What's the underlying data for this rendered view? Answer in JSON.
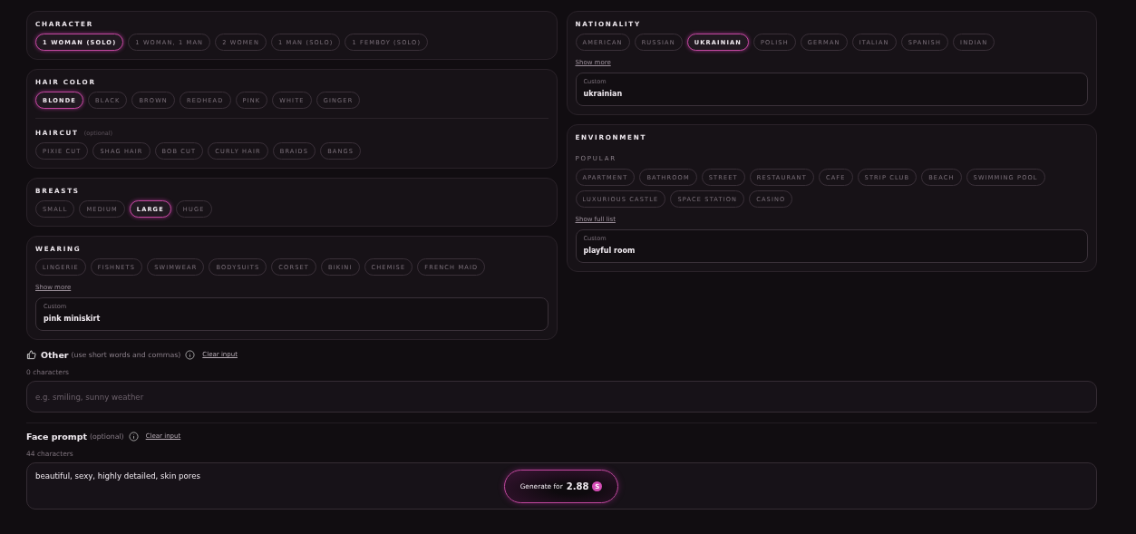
{
  "left_column": [
    {
      "groups": [
        {
          "title": "CHARACTER",
          "options": [
            {
              "label": "1 WOMAN (SOLO)",
              "selected": true
            },
            {
              "label": "1 WOMAN, 1 MAN",
              "selected": false
            },
            {
              "label": "2 WOMEN",
              "selected": false
            },
            {
              "label": "1 MAN (SOLO)",
              "selected": false
            },
            {
              "label": "1 FEMBOY (SOLO)",
              "selected": false
            }
          ]
        }
      ]
    },
    {
      "groups": [
        {
          "title": "HAIR COLOR",
          "options": [
            {
              "label": "BLONDE",
              "selected": true
            },
            {
              "label": "BLACK",
              "selected": false
            },
            {
              "label": "BROWN",
              "selected": false
            },
            {
              "label": "REDHEAD",
              "selected": false
            },
            {
              "label": "PINK",
              "selected": false
            },
            {
              "label": "WHITE",
              "selected": false
            },
            {
              "label": "GINGER",
              "selected": false
            }
          ]
        },
        {
          "title": "HAIRCUT",
          "note": "(optional)",
          "options": [
            {
              "label": "PIXIE CUT",
              "selected": false
            },
            {
              "label": "SHAG HAIR",
              "selected": false
            },
            {
              "label": "BOB CUT",
              "selected": false
            },
            {
              "label": "CURLY HAIR",
              "selected": false
            },
            {
              "label": "BRAIDS",
              "selected": false
            },
            {
              "label": "BANGS",
              "selected": false
            }
          ]
        }
      ]
    },
    {
      "groups": [
        {
          "title": "BREASTS",
          "options": [
            {
              "label": "SMALL",
              "selected": false
            },
            {
              "label": "MEDIUM",
              "selected": false
            },
            {
              "label": "LARGE",
              "selected": true
            },
            {
              "label": "HUGE",
              "selected": false
            }
          ]
        }
      ]
    },
    {
      "groups": [
        {
          "title": "WEARING",
          "options": [
            {
              "label": "LINGERIE",
              "selected": false
            },
            {
              "label": "FISHNETS",
              "selected": false
            },
            {
              "label": "SWIMWEAR",
              "selected": false
            },
            {
              "label": "BODYSUITS",
              "selected": false
            },
            {
              "label": "CORSET",
              "selected": false
            },
            {
              "label": "BIKINI",
              "selected": false
            },
            {
              "label": "CHEMISE",
              "selected": false
            },
            {
              "label": "FRENCH MAID",
              "selected": false
            }
          ]
        }
      ],
      "show_more": "Show more",
      "custom": {
        "label": "Custom",
        "value": "pink miniskirt"
      }
    }
  ],
  "right_column": [
    {
      "groups": [
        {
          "title": "NATIONALITY",
          "options": [
            {
              "label": "AMERICAN",
              "selected": false
            },
            {
              "label": "RUSSIAN",
              "selected": false
            },
            {
              "label": "UKRAINIAN",
              "selected": true
            },
            {
              "label": "POLISH",
              "selected": false
            },
            {
              "label": "GERMAN",
              "selected": false
            },
            {
              "label": "ITALIAN",
              "selected": false
            },
            {
              "label": "SPANISH",
              "selected": false
            },
            {
              "label": "INDIAN",
              "selected": false
            }
          ]
        }
      ],
      "show_more": "Show more",
      "custom": {
        "label": "Custom",
        "value": "ukrainian"
      }
    },
    {
      "groups": [
        {
          "title": "ENVIRONMENT",
          "subtitle": "POPULAR",
          "options": [
            {
              "label": "APARTMENT",
              "selected": false
            },
            {
              "label": "BATHROOM",
              "selected": false
            },
            {
              "label": "STREET",
              "selected": false
            },
            {
              "label": "RESTAURANT",
              "selected": false
            },
            {
              "label": "CAFE",
              "selected": false
            },
            {
              "label": "STRIP CLUB",
              "selected": false
            },
            {
              "label": "BEACH",
              "selected": false
            },
            {
              "label": "SWIMMING POOL",
              "selected": false
            },
            {
              "label": "LUXURIOUS CASTLE",
              "selected": false
            },
            {
              "label": "SPACE STATION",
              "selected": false
            },
            {
              "label": "CASINO",
              "selected": false
            }
          ]
        }
      ],
      "show_more": "Show full list",
      "custom": {
        "label": "Custom",
        "value": "playful room"
      }
    }
  ],
  "other": {
    "label": "Other",
    "note": "(use short words and commas)",
    "clear": "Clear input",
    "count": "0 characters",
    "placeholder": "e.g. smiling, sunny weather"
  },
  "face_prompt": {
    "label": "Face prompt",
    "note": "(optional)",
    "clear": "Clear input",
    "count": "44 characters",
    "value": "beautiful, sexy, highly detailed, skin pores",
    "generate": {
      "label": "Generate for",
      "price": "2.88",
      "currency": "S"
    }
  }
}
